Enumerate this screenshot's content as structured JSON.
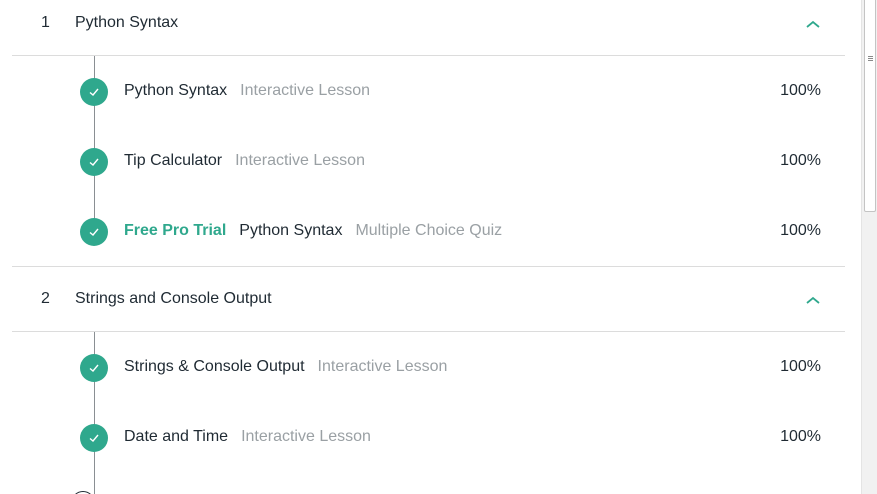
{
  "colors": {
    "accent": "#2fa88d",
    "text": "#1f2a33",
    "muted": "#9aa0a4",
    "divider": "#dcdcdc"
  },
  "sections": [
    {
      "number": "1",
      "title": "Python Syntax",
      "expanded_icon": "chevron-up-icon",
      "lessons": [
        {
          "badge": "",
          "title": "Python Syntax",
          "type": "Interactive Lesson",
          "percent": "100%",
          "status": "complete"
        },
        {
          "badge": "",
          "title": "Tip Calculator",
          "type": "Interactive Lesson",
          "percent": "100%",
          "status": "complete"
        },
        {
          "badge": "Free Pro Trial",
          "title": "Python Syntax",
          "type": "Multiple Choice Quiz",
          "percent": "100%",
          "status": "complete"
        }
      ]
    },
    {
      "number": "2",
      "title": "Strings and Console Output",
      "expanded_icon": "chevron-up-icon",
      "lessons": [
        {
          "badge": "",
          "title": "Strings & Console Output",
          "type": "Interactive Lesson",
          "percent": "100%",
          "status": "complete"
        },
        {
          "badge": "",
          "title": "Date and Time",
          "type": "Interactive Lesson",
          "percent": "100%",
          "status": "complete"
        }
      ]
    }
  ]
}
